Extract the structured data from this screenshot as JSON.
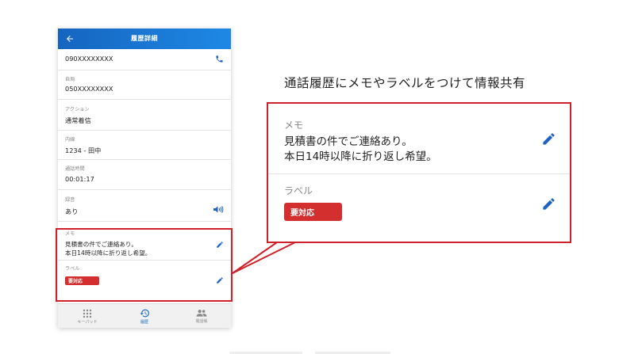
{
  "app_bar": {
    "title": "履歴詳細"
  },
  "details": {
    "phone_number": {
      "value": "090XXXXXXXX"
    },
    "own_station": {
      "label": "自局",
      "value": "050XXXXXXXX"
    },
    "action": {
      "label": "アクション",
      "value": "通常着信"
    },
    "extension": {
      "label": "内線",
      "value": "1234 - 田中"
    },
    "call_duration": {
      "label": "通話時間",
      "value": "00:01:17"
    },
    "recording": {
      "label": "録音",
      "value": "あり"
    },
    "memo": {
      "label": "メモ",
      "line1": "見積書の件でご連絡あり。",
      "line2": "本日14時以降に折り返し希望。"
    },
    "label": {
      "label": "ラベル",
      "tag": "要対応"
    }
  },
  "bottom_nav": {
    "keypad": "キーパッド",
    "history": "履歴",
    "phonebook": "電話帳"
  },
  "callout": {
    "heading": "通話履歴にメモやラベルをつけて情報共有",
    "memo_label": "メモ",
    "memo_line1": "見積書の件でご連絡あり。",
    "memo_line2": "本日14時以降に折り返し希望。",
    "label_label": "ラベル",
    "label_tag": "要対応"
  },
  "colors": {
    "accent": "#1565c0",
    "highlight": "#d0202a",
    "tag": "#d32f2f"
  }
}
